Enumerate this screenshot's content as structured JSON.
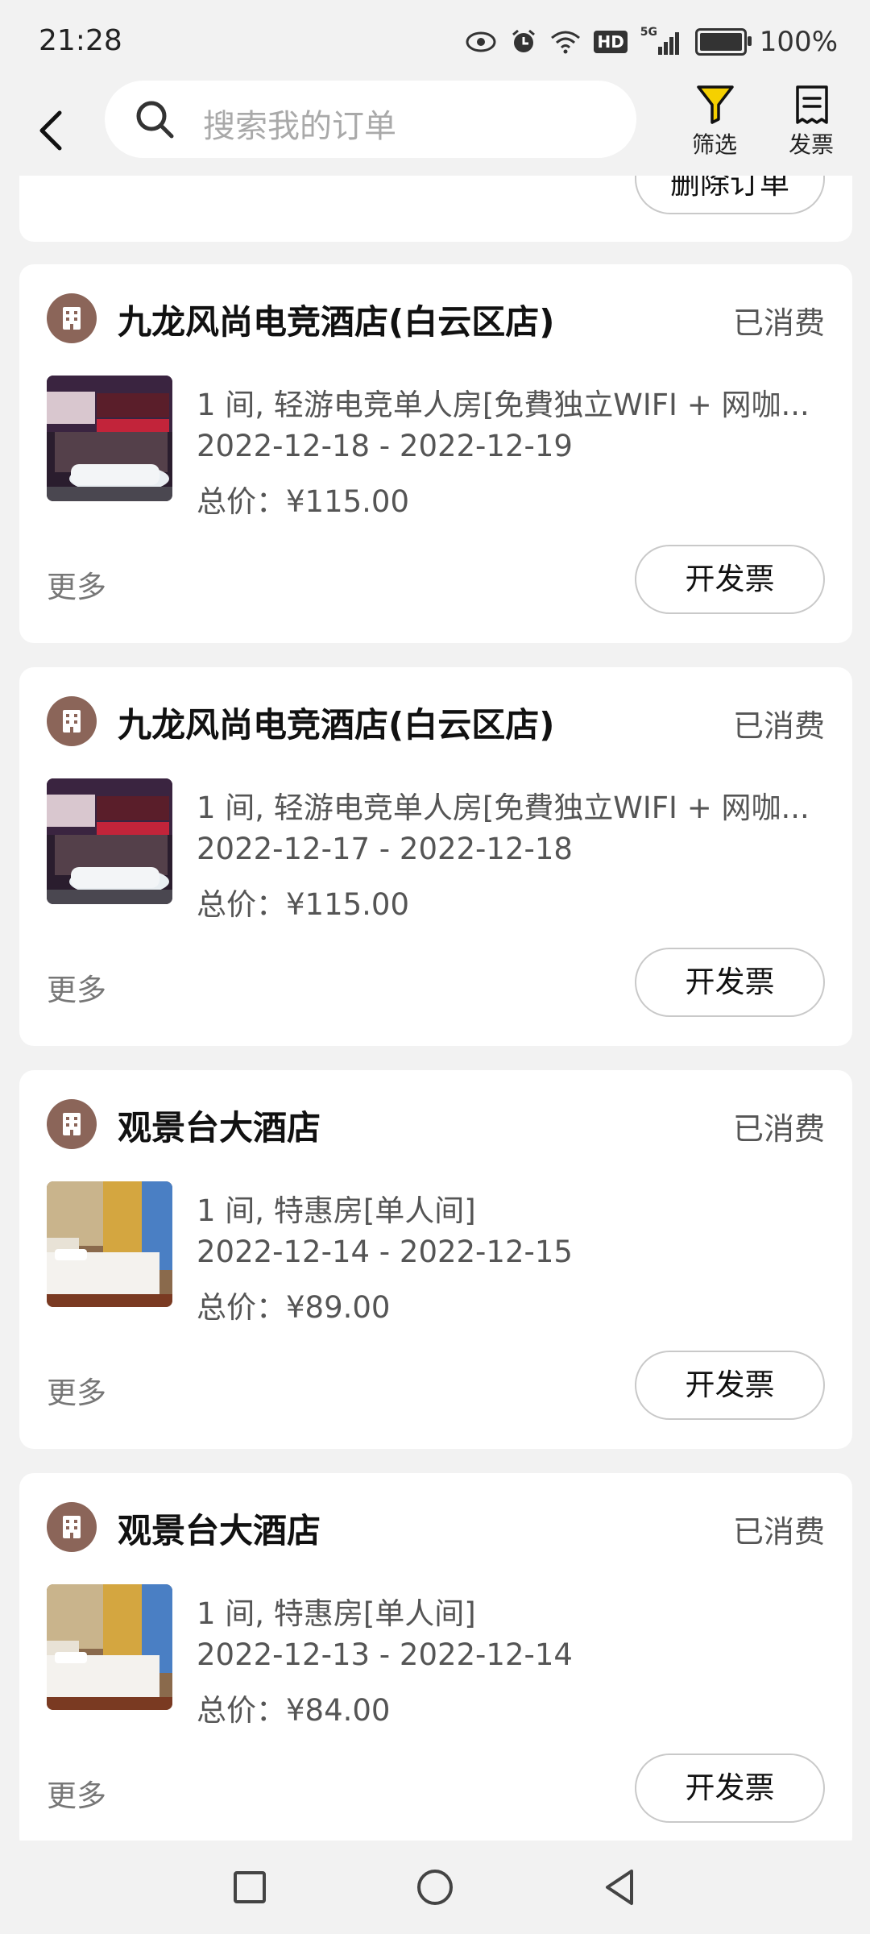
{
  "status_bar": {
    "time": "21:28",
    "battery": "100%",
    "network": "5G",
    "hd": "HD"
  },
  "header": {
    "search_placeholder": "搜索我的订单",
    "filter_label": "筛选",
    "invoice_label": "发票"
  },
  "partial_card": {
    "delete_label": "删除订单"
  },
  "orders": [
    {
      "hotel": "九龙风尚电竞酒店(白云区店)",
      "status": "已消费",
      "room": "1 间, 轻游电竞单人房[免費独立WIFI + 网咖...",
      "dates": "2022-12-18 - 2022-12-19",
      "price": "总价：¥115.00",
      "more": "更多",
      "action": "开发票"
    },
    {
      "hotel": "九龙风尚电竞酒店(白云区店)",
      "status": "已消费",
      "room": "1 间, 轻游电竞单人房[免費独立WIFI + 网咖...",
      "dates": "2022-12-17 - 2022-12-18",
      "price": "总价：¥115.00",
      "more": "更多",
      "action": "开发票"
    },
    {
      "hotel": "观景台大酒店",
      "status": "已消费",
      "room": "1 间, 特惠房[单人间]",
      "dates": "2022-12-14 - 2022-12-15",
      "price": "总价：¥89.00",
      "more": "更多",
      "action": "开发票"
    },
    {
      "hotel": "观景台大酒店",
      "status": "已消费",
      "room": "1 间, 特惠房[单人间]",
      "dates": "2022-12-13 - 2022-12-14",
      "price": "总价：¥84.00",
      "more": "更多",
      "action": "开发票"
    }
  ],
  "colors": {
    "background": "#f2f2f2",
    "card": "#ffffff",
    "hotel_icon": "#8b6559",
    "filter_icon": "#f5d000"
  }
}
